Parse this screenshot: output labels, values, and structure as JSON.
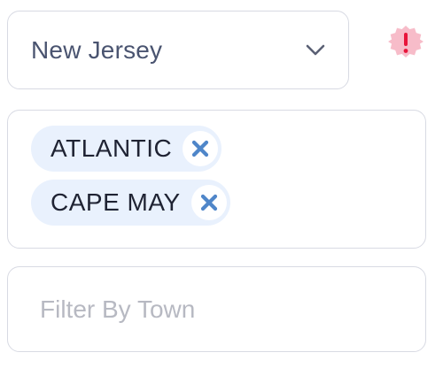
{
  "state_select": {
    "value": "New Jersey",
    "icon": "chevron-down-icon"
  },
  "alert": {
    "icon": "alert-badge-icon",
    "symbol": "!",
    "color": "#e8153b",
    "badge_color": "#f7bcc9"
  },
  "counties": {
    "chips": [
      {
        "label": "ATLANTIC",
        "remove_icon": "close-icon"
      },
      {
        "label": "CAPE MAY",
        "remove_icon": "close-icon"
      }
    ],
    "chip_bg": "#e9f1fd",
    "remove_icon_color": "#4f86c9"
  },
  "town_filter": {
    "placeholder": "Filter By Town",
    "value": ""
  }
}
